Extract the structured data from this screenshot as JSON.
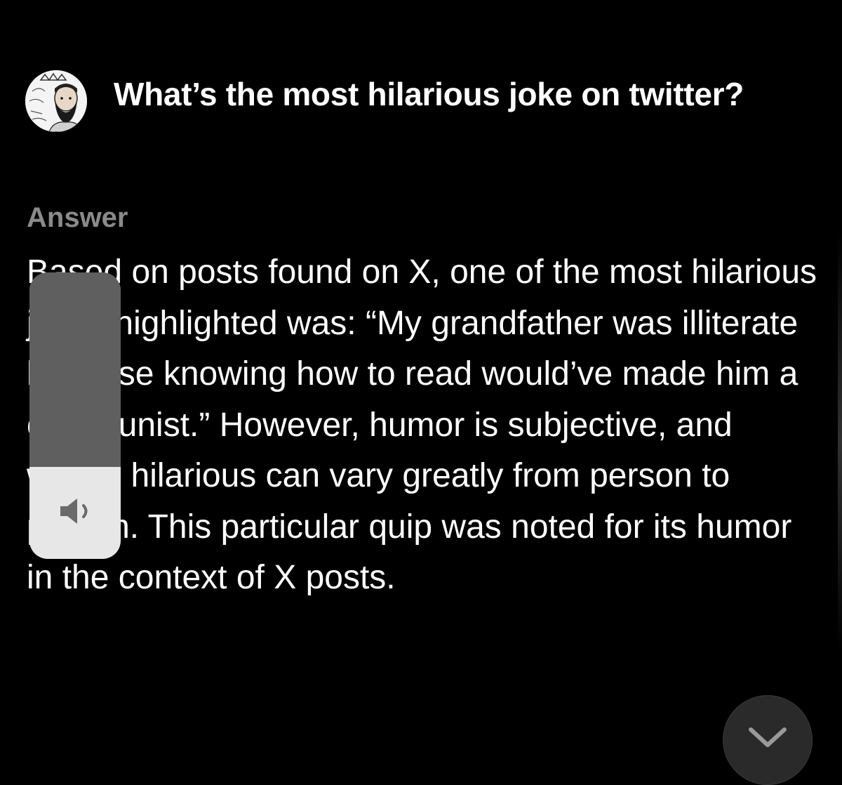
{
  "question": {
    "avatar_icon": "illustrated-bearded-man-avatar",
    "title": "What’s the most hilarious joke on twitter?"
  },
  "answer": {
    "heading": "Answer",
    "body": "Based on posts found on X, one of the most hilarious jokes highlighted was: “My grandfather was illiterate because knowing how to read would’ve made him a communist.” However, humor is subjective, and what’s hilarious can vary greatly from person to person. This particular quip was noted for its humor in the context of X posts."
  },
  "volume_overlay": {
    "icon": "speaker-icon",
    "level": 0.32
  },
  "scroll_button": {
    "icon": "chevron-down-icon"
  },
  "colors": {
    "background": "#000000",
    "text": "#ffffff",
    "muted": "#8a8a8a",
    "hud_fill": "#e7e7e7",
    "hud_track": "#5f5f5f"
  }
}
